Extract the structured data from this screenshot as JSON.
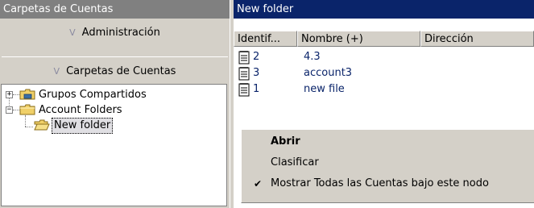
{
  "left_pane": {
    "title": "Carpetas de Cuentas",
    "sections": [
      {
        "label": "Administración"
      },
      {
        "label": "Carpetas de Cuentas"
      }
    ],
    "tree": [
      {
        "label": "Grupos Compartidos",
        "expander": "+",
        "icon": "shared-folder-icon"
      },
      {
        "label": "Account Folders",
        "expander": "−",
        "icon": "folder-icon"
      },
      {
        "label": "New folder",
        "icon": "open-folder-icon",
        "selected": true
      }
    ]
  },
  "right_pane": {
    "title": "New folder",
    "columns": [
      "Identif...",
      "Nombre (+)",
      "Dirección"
    ],
    "rows": [
      {
        "id": "2",
        "name": "4.3"
      },
      {
        "id": "3",
        "name": "account3"
      },
      {
        "id": "1",
        "name": "new file"
      }
    ]
  },
  "context_menu": {
    "items": [
      {
        "label": "Abrir",
        "bold": true,
        "checked": false
      },
      {
        "label": "Clasificar",
        "bold": false,
        "checked": false
      },
      {
        "label": "Mostrar Todas las Cuentas bajo este nodo",
        "bold": false,
        "checked": true
      }
    ]
  },
  "colors": {
    "active_title": "#0a246a",
    "inactive_title": "#808080",
    "face": "#d4d0c8",
    "folder": "#f0d068"
  }
}
